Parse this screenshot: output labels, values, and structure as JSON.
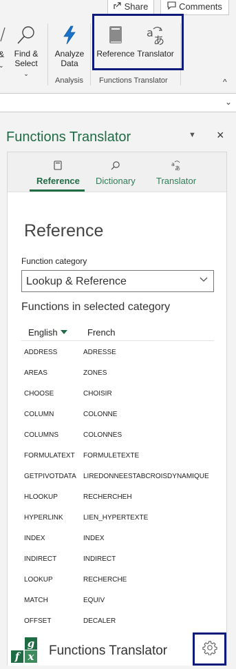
{
  "header_buttons": {
    "share": "Share",
    "comments": "Comments"
  },
  "ribbon": {
    "find_partial_label": "&",
    "find_label_line1": "Find &",
    "find_label_line2": "Select",
    "analyze_line1": "Analyze",
    "analyze_line2": "Data",
    "analysis_group": "Analysis",
    "reference_label": "Reference",
    "translator_label": "Translator",
    "functions_group": "Functions Translator"
  },
  "pane": {
    "title": "Functions Translator",
    "tabs": [
      {
        "label": "Reference",
        "icon": "book-icon",
        "active": true
      },
      {
        "label": "Dictionary",
        "icon": "search-icon",
        "active": false
      },
      {
        "label": "Translator",
        "icon": "translate-icon",
        "active": false
      }
    ],
    "heading": "Reference",
    "category_label": "Function category",
    "category_value": "Lookup & Reference",
    "functions_heading": "Functions in selected category",
    "column_english": "English",
    "column_french": "French",
    "functions": [
      {
        "en": "ADDRESS",
        "fr": "ADRESSE"
      },
      {
        "en": "AREAS",
        "fr": "ZONES"
      },
      {
        "en": "CHOOSE",
        "fr": "CHOISIR"
      },
      {
        "en": "COLUMN",
        "fr": "COLONNE"
      },
      {
        "en": "COLUMNS",
        "fr": "COLONNES"
      },
      {
        "en": "FORMULATEXT",
        "fr": "FORMULETEXTE"
      },
      {
        "en": "GETPIVOTDATA",
        "fr": "LIREDONNEESTABCROISDYNAMIQUE"
      },
      {
        "en": "HLOOKUP",
        "fr": "RECHERCHEH"
      },
      {
        "en": "HYPERLINK",
        "fr": "LIEN_HYPERTEXTE"
      },
      {
        "en": "INDEX",
        "fr": "INDEX"
      },
      {
        "en": "INDIRECT",
        "fr": "INDIRECT"
      },
      {
        "en": "LOOKUP",
        "fr": "RECHERCHE"
      },
      {
        "en": "MATCH",
        "fr": "EQUIV"
      },
      {
        "en": "OFFSET",
        "fr": "DECALER"
      }
    ],
    "footer_title": "Functions Translator",
    "logo_letters": [
      "g",
      "f",
      "x"
    ]
  },
  "colors": {
    "accent_green": "#1e6b44",
    "highlight_navy": "#0d1a7a",
    "analyze_blue": "#1b73c9"
  }
}
